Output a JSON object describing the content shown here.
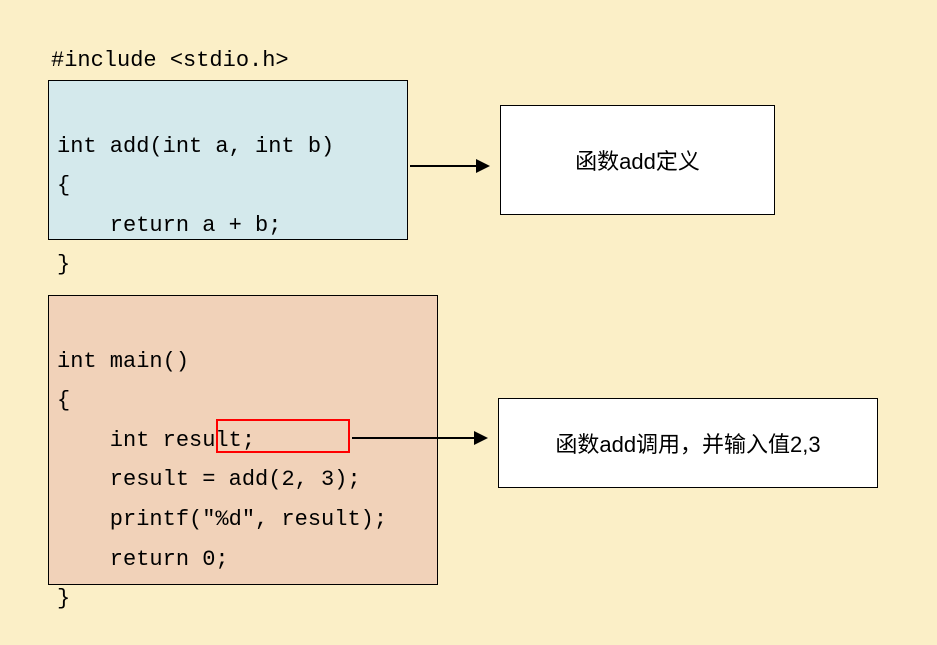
{
  "include_line": "#include <stdio.h>",
  "add_box": {
    "code": "int add(int a, int b)\n{\n    return a + b;\n}"
  },
  "main_box": {
    "line1": "int main()",
    "line2": "{",
    "line3_indent": "    int result;",
    "line4_prefix": "    result = ",
    "line4_highlight": "add(2, 3)",
    "line4_suffix": ";",
    "line5": "    printf(\"%d\", result);",
    "line6": "    return 0;",
    "line7": "}"
  },
  "labels": {
    "add_def": "函数add定义",
    "add_call": "函数add调用，并输入值2,3"
  }
}
